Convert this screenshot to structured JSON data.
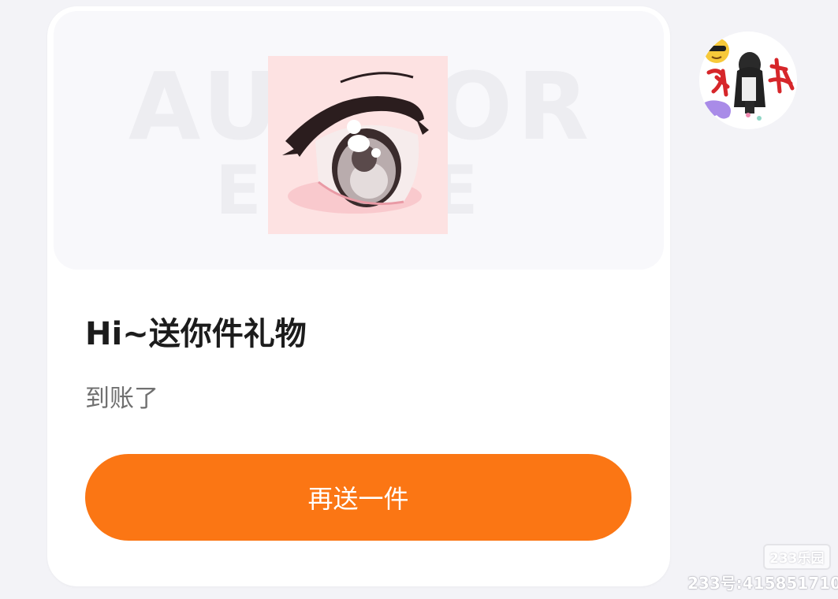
{
  "card": {
    "banner_watermark_line1": "AUTHOR",
    "banner_watermark_line2": "ESHRE",
    "gift_image_icon": "anime-eye-icon",
    "title": "Hi~送你件礼物",
    "subtitle": "到账了",
    "send_again_label": "再送一件"
  },
  "avatar": {
    "icon": "user-avatar-icon",
    "accent_color": "#d6262a"
  },
  "watermark": {
    "site_logo": "233乐园",
    "user_id": "233号:415851710"
  },
  "colors": {
    "accent": "#fb7614",
    "background": "#f3f3f7",
    "card": "#ffffff"
  }
}
